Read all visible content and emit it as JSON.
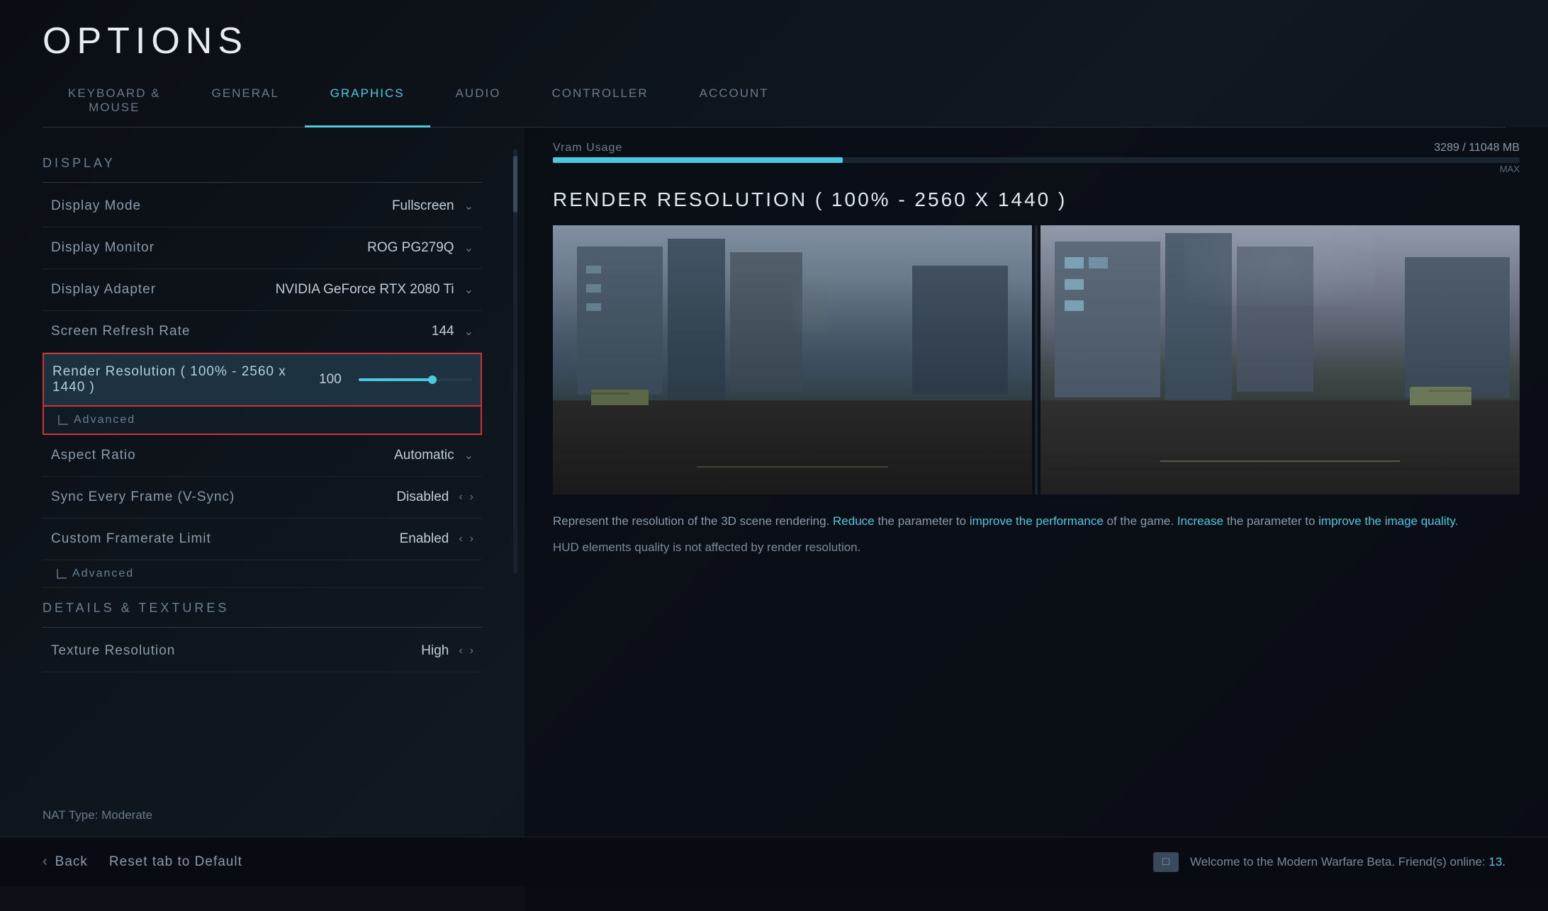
{
  "page": {
    "title": "OPTIONS"
  },
  "tabs": [
    {
      "id": "keyboard",
      "label": "KEYBOARD &\nMOUSE",
      "active": false
    },
    {
      "id": "general",
      "label": "GENERAL",
      "active": false
    },
    {
      "id": "graphics",
      "label": "GRAPHICS",
      "active": true
    },
    {
      "id": "audio",
      "label": "AUDIO",
      "active": false
    },
    {
      "id": "controller",
      "label": "CONTROLLER",
      "active": false
    },
    {
      "id": "account",
      "label": "ACCOUNT",
      "active": false
    }
  ],
  "display_section": {
    "label": "DISPLAY",
    "settings": [
      {
        "label": "Display Mode",
        "value": "Fullscreen",
        "type": "dropdown"
      },
      {
        "label": "Display Monitor",
        "value": "ROG PG279Q",
        "type": "dropdown"
      },
      {
        "label": "Display Adapter",
        "value": "NVIDIA GeForce RTX 2080 Ti",
        "type": "dropdown"
      },
      {
        "label": "Screen Refresh Rate",
        "value": "144",
        "type": "dropdown"
      }
    ],
    "render_resolution": {
      "label": "Render Resolution ( 100% - 2560 x 1440 )",
      "value": "100",
      "slider_percent": 65
    },
    "advanced_sub_display": "Advanced",
    "aspect_ratio": {
      "label": "Aspect Ratio",
      "value": "Automatic",
      "type": "dropdown"
    },
    "vsync": {
      "label": "Sync Every Frame (V-Sync)",
      "value": "Disabled",
      "type": "arrows"
    },
    "framerate": {
      "label": "Custom Framerate Limit",
      "value": "Enabled",
      "type": "arrows"
    },
    "advanced_sub_bottom": "Advanced"
  },
  "details_section": {
    "label": "DETAILS & TEXTURES",
    "texture_resolution": {
      "label": "Texture Resolution",
      "value": "High",
      "type": "arrows"
    }
  },
  "vram": {
    "label": "Vram Usage",
    "current": "3289",
    "total": "11048",
    "unit": "MB",
    "max_label": "MAX",
    "fill_percent": 30
  },
  "right_panel": {
    "render_title": "RENDER RESOLUTION ( 100% - 2560 X 1440 )",
    "description": {
      "part1": "Represent the resolution of the 3D scene rendering. ",
      "reduce": "Reduce",
      "part2": " the parameter to ",
      "improve1": "improve the performance",
      "part3": " of the game. ",
      "increase": "Increase",
      "part4": " the parameter to ",
      "improve2": "improve the image quality",
      "part5": "."
    },
    "hud_note": "HUD elements quality is not affected by render resolution."
  },
  "bottom": {
    "back_label": "Back",
    "reset_label": "Reset tab to Default",
    "welcome_text": "Welcome to the Modern Warfare Beta. Friend(s) online: ",
    "friends_online": "13.",
    "nat_type": "NAT Type: Moderate"
  }
}
